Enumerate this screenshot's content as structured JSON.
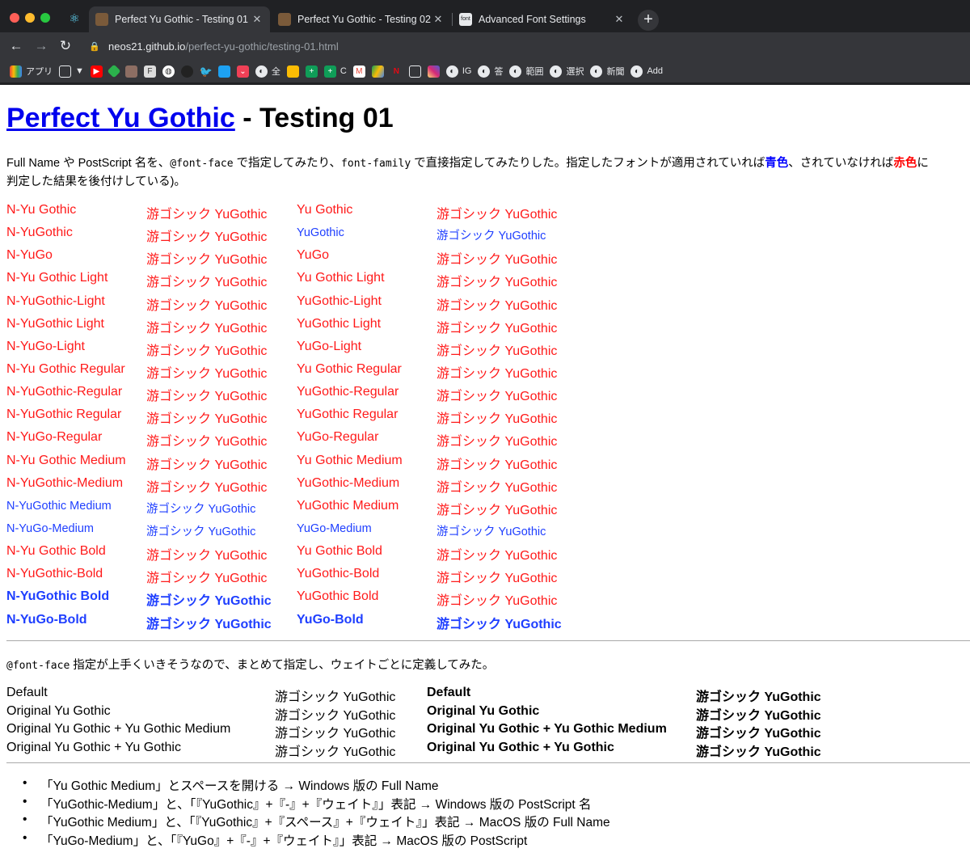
{
  "browser": {
    "tabs": [
      {
        "title": "Perfect Yu Gothic - Testing 01",
        "active": true,
        "close": "✕"
      },
      {
        "title": "Perfect Yu Gothic - Testing 02",
        "active": false,
        "close": "✕"
      },
      {
        "title": "Advanced Font Settings",
        "active": false,
        "close": "✕"
      }
    ],
    "new_tab": "+",
    "url_host": "neos21.github.io",
    "url_path": "/perfect-yu-gothic/testing-01.html",
    "bookmarks": [
      {
        "label": "アプリ",
        "icon": "apps-grid-icon"
      },
      {
        "label": "▼",
        "icon": "folder-icon"
      },
      {
        "label": "",
        "icon": "youtube-icon"
      },
      {
        "label": "",
        "icon": "feedly-icon"
      },
      {
        "label": "",
        "icon": "image-icon"
      },
      {
        "label": "",
        "icon": "f-icon"
      },
      {
        "label": "",
        "icon": "circle-icon"
      },
      {
        "label": "",
        "icon": "github-icon"
      },
      {
        "label": "",
        "icon": "twitter-icon"
      },
      {
        "label": "",
        "icon": "twitter-square-icon"
      },
      {
        "label": "",
        "icon": "pocket-icon"
      },
      {
        "label": "全",
        "icon": "globe-icon"
      },
      {
        "label": "",
        "icon": "keep-icon"
      },
      {
        "label": "",
        "icon": "plus-icon"
      },
      {
        "label": "C",
        "icon": "plus-icon"
      },
      {
        "label": "",
        "icon": "gmail-icon"
      },
      {
        "label": "",
        "icon": "drive-icon"
      },
      {
        "label": "",
        "icon": "netflix-icon"
      },
      {
        "label": "",
        "icon": "folder-icon"
      },
      {
        "label": "",
        "icon": "instagram-icon"
      },
      {
        "label": "IG",
        "icon": "globe-icon"
      },
      {
        "label": "答",
        "icon": "globe-icon"
      },
      {
        "label": "範囲",
        "icon": "globe-icon"
      },
      {
        "label": "選択",
        "icon": "globe-icon"
      },
      {
        "label": "新聞",
        "icon": "globe-icon"
      },
      {
        "label": "Add",
        "icon": "globe-icon"
      }
    ]
  },
  "page": {
    "title_link": "Perfect Yu Gothic",
    "title_rest": " - Testing 01",
    "intro": {
      "p1": "Full Name や PostScript 名を、",
      "code1": "@font-face",
      "p2": " で指定してみたり、",
      "code2": "font-family",
      "p3": " で直接指定してみたりした。指定したフォントが適用されていれば",
      "blue": "青色",
      "p4": "、されていなければ",
      "red": "赤色",
      "p5": "に",
      "line2": "判定した結果を後付けしている)。"
    },
    "grid": [
      {
        "c1": "N-Yu Gothic",
        "c1s": "red",
        "c2": "游ゴシック YuGothic",
        "c2s": "red",
        "c3": "Yu Gothic",
        "c3s": "red",
        "c4": "游ゴシック YuGothic",
        "c4s": "red"
      },
      {
        "c1": "N-YuGothic",
        "c1s": "red",
        "c2": "游ゴシック YuGothic",
        "c2s": "red",
        "c3": "YuGothic",
        "c3s": "blue",
        "c4": "游ゴシック YuGothic",
        "c4s": "blue"
      },
      {
        "c1": "N-YuGo",
        "c1s": "red",
        "c2": "游ゴシック YuGothic",
        "c2s": "red",
        "c3": "YuGo",
        "c3s": "red",
        "c4": "游ゴシック YuGothic",
        "c4s": "red"
      },
      {
        "c1": "N-Yu Gothic Light",
        "c1s": "red",
        "c2": "游ゴシック YuGothic",
        "c2s": "red",
        "c3": "Yu Gothic Light",
        "c3s": "red",
        "c4": "游ゴシック YuGothic",
        "c4s": "red"
      },
      {
        "c1": "N-YuGothic-Light",
        "c1s": "red",
        "c2": "游ゴシック YuGothic",
        "c2s": "red",
        "c3": "YuGothic-Light",
        "c3s": "red",
        "c4": "游ゴシック YuGothic",
        "c4s": "red"
      },
      {
        "c1": "N-YuGothic Light",
        "c1s": "red",
        "c2": "游ゴシック YuGothic",
        "c2s": "red",
        "c3": "YuGothic Light",
        "c3s": "red",
        "c4": "游ゴシック YuGothic",
        "c4s": "red"
      },
      {
        "c1": "N-YuGo-Light",
        "c1s": "red",
        "c2": "游ゴシック YuGothic",
        "c2s": "red",
        "c3": "YuGo-Light",
        "c3s": "red",
        "c4": "游ゴシック YuGothic",
        "c4s": "red"
      },
      {
        "c1": "N-Yu Gothic Regular",
        "c1s": "red",
        "c2": "游ゴシック YuGothic",
        "c2s": "red",
        "c3": "Yu Gothic Regular",
        "c3s": "red",
        "c4": "游ゴシック YuGothic",
        "c4s": "red"
      },
      {
        "c1": "N-YuGothic-Regular",
        "c1s": "red",
        "c2": "游ゴシック YuGothic",
        "c2s": "red",
        "c3": "YuGothic-Regular",
        "c3s": "red",
        "c4": "游ゴシック YuGothic",
        "c4s": "red"
      },
      {
        "c1": "N-YuGothic Regular",
        "c1s": "red",
        "c2": "游ゴシック YuGothic",
        "c2s": "red",
        "c3": "YuGothic Regular",
        "c3s": "red",
        "c4": "游ゴシック YuGothic",
        "c4s": "red"
      },
      {
        "c1": "N-YuGo-Regular",
        "c1s": "red",
        "c2": "游ゴシック YuGothic",
        "c2s": "red",
        "c3": "YuGo-Regular",
        "c3s": "red",
        "c4": "游ゴシック YuGothic",
        "c4s": "red"
      },
      {
        "c1": "N-Yu Gothic Medium",
        "c1s": "red",
        "c2": "游ゴシック YuGothic",
        "c2s": "red",
        "c3": "Yu Gothic Medium",
        "c3s": "red",
        "c4": "游ゴシック YuGothic",
        "c4s": "red"
      },
      {
        "c1": "N-YuGothic-Medium",
        "c1s": "red",
        "c2": "游ゴシック YuGothic",
        "c2s": "red",
        "c3": "YuGothic-Medium",
        "c3s": "red",
        "c4": "游ゴシック YuGothic",
        "c4s": "red"
      },
      {
        "c1": "N-YuGothic Medium",
        "c1s": "blue",
        "c2": "游ゴシック YuGothic",
        "c2s": "blue",
        "c3": "YuGothic Medium",
        "c3s": "red",
        "c4": "游ゴシック YuGothic",
        "c4s": "red"
      },
      {
        "c1": "N-YuGo-Medium",
        "c1s": "blue",
        "c2": "游ゴシック YuGothic",
        "c2s": "blue",
        "c3": "YuGo-Medium",
        "c3s": "blue",
        "c4": "游ゴシック YuGothic",
        "c4s": "blue"
      },
      {
        "c1": "N-Yu Gothic Bold",
        "c1s": "red",
        "c2": "游ゴシック YuGothic",
        "c2s": "red",
        "c3": "Yu Gothic Bold",
        "c3s": "red",
        "c4": "游ゴシック YuGothic",
        "c4s": "red"
      },
      {
        "c1": "N-YuGothic-Bold",
        "c1s": "red",
        "c2": "游ゴシック YuGothic",
        "c2s": "red",
        "c3": "YuGothic-Bold",
        "c3s": "red",
        "c4": "游ゴシック YuGothic",
        "c4s": "red"
      },
      {
        "c1": "N-YuGothic Bold",
        "c1s": "blue-bold",
        "c2": "游ゴシック YuGothic",
        "c2s": "blue-bold",
        "c3": "YuGothic Bold",
        "c3s": "red",
        "c4": "游ゴシック YuGothic",
        "c4s": "red"
      },
      {
        "c1": "N-YuGo-Bold",
        "c1s": "blue-bold",
        "c2": "游ゴシック YuGothic",
        "c2s": "blue-bold",
        "c3": "YuGo-Bold",
        "c3s": "blue-bold",
        "c4": "游ゴシック YuGothic",
        "c4s": "blue-bold"
      }
    ],
    "note2_code": "@font-face",
    "note2_text": " 指定が上手くいきそうなので、まとめて指定し、ウェイトごとに定義してみた。",
    "weights": [
      {
        "name": "Default",
        "sample": "游ゴシック YuGothic"
      },
      {
        "name": "Original Yu Gothic",
        "sample": "游ゴシック YuGothic"
      },
      {
        "name": "Original Yu Gothic + Yu Gothic Medium",
        "sample": "游ゴシック YuGothic"
      },
      {
        "name": "Original Yu Gothic + Yu Gothic",
        "sample": "游ゴシック YuGothic"
      }
    ],
    "bullets": [
      "「Yu Gothic Medium」とスペースを開ける → Windows 版の Full Name",
      "「YuGothic-Medium」と、「『YuGothic』+『-』+『ウェイト』」表記 → Windows 版の PostScript 名",
      "「YuGothic Medium」と、「『YuGothic』+『スペース』+『ウェイト』」表記 → MacOS 版の Full Name",
      "「YuGo-Medium」と、「『YuGo』+『-』+『ウェイト』」表記 → MacOS 版の PostScript"
    ]
  }
}
